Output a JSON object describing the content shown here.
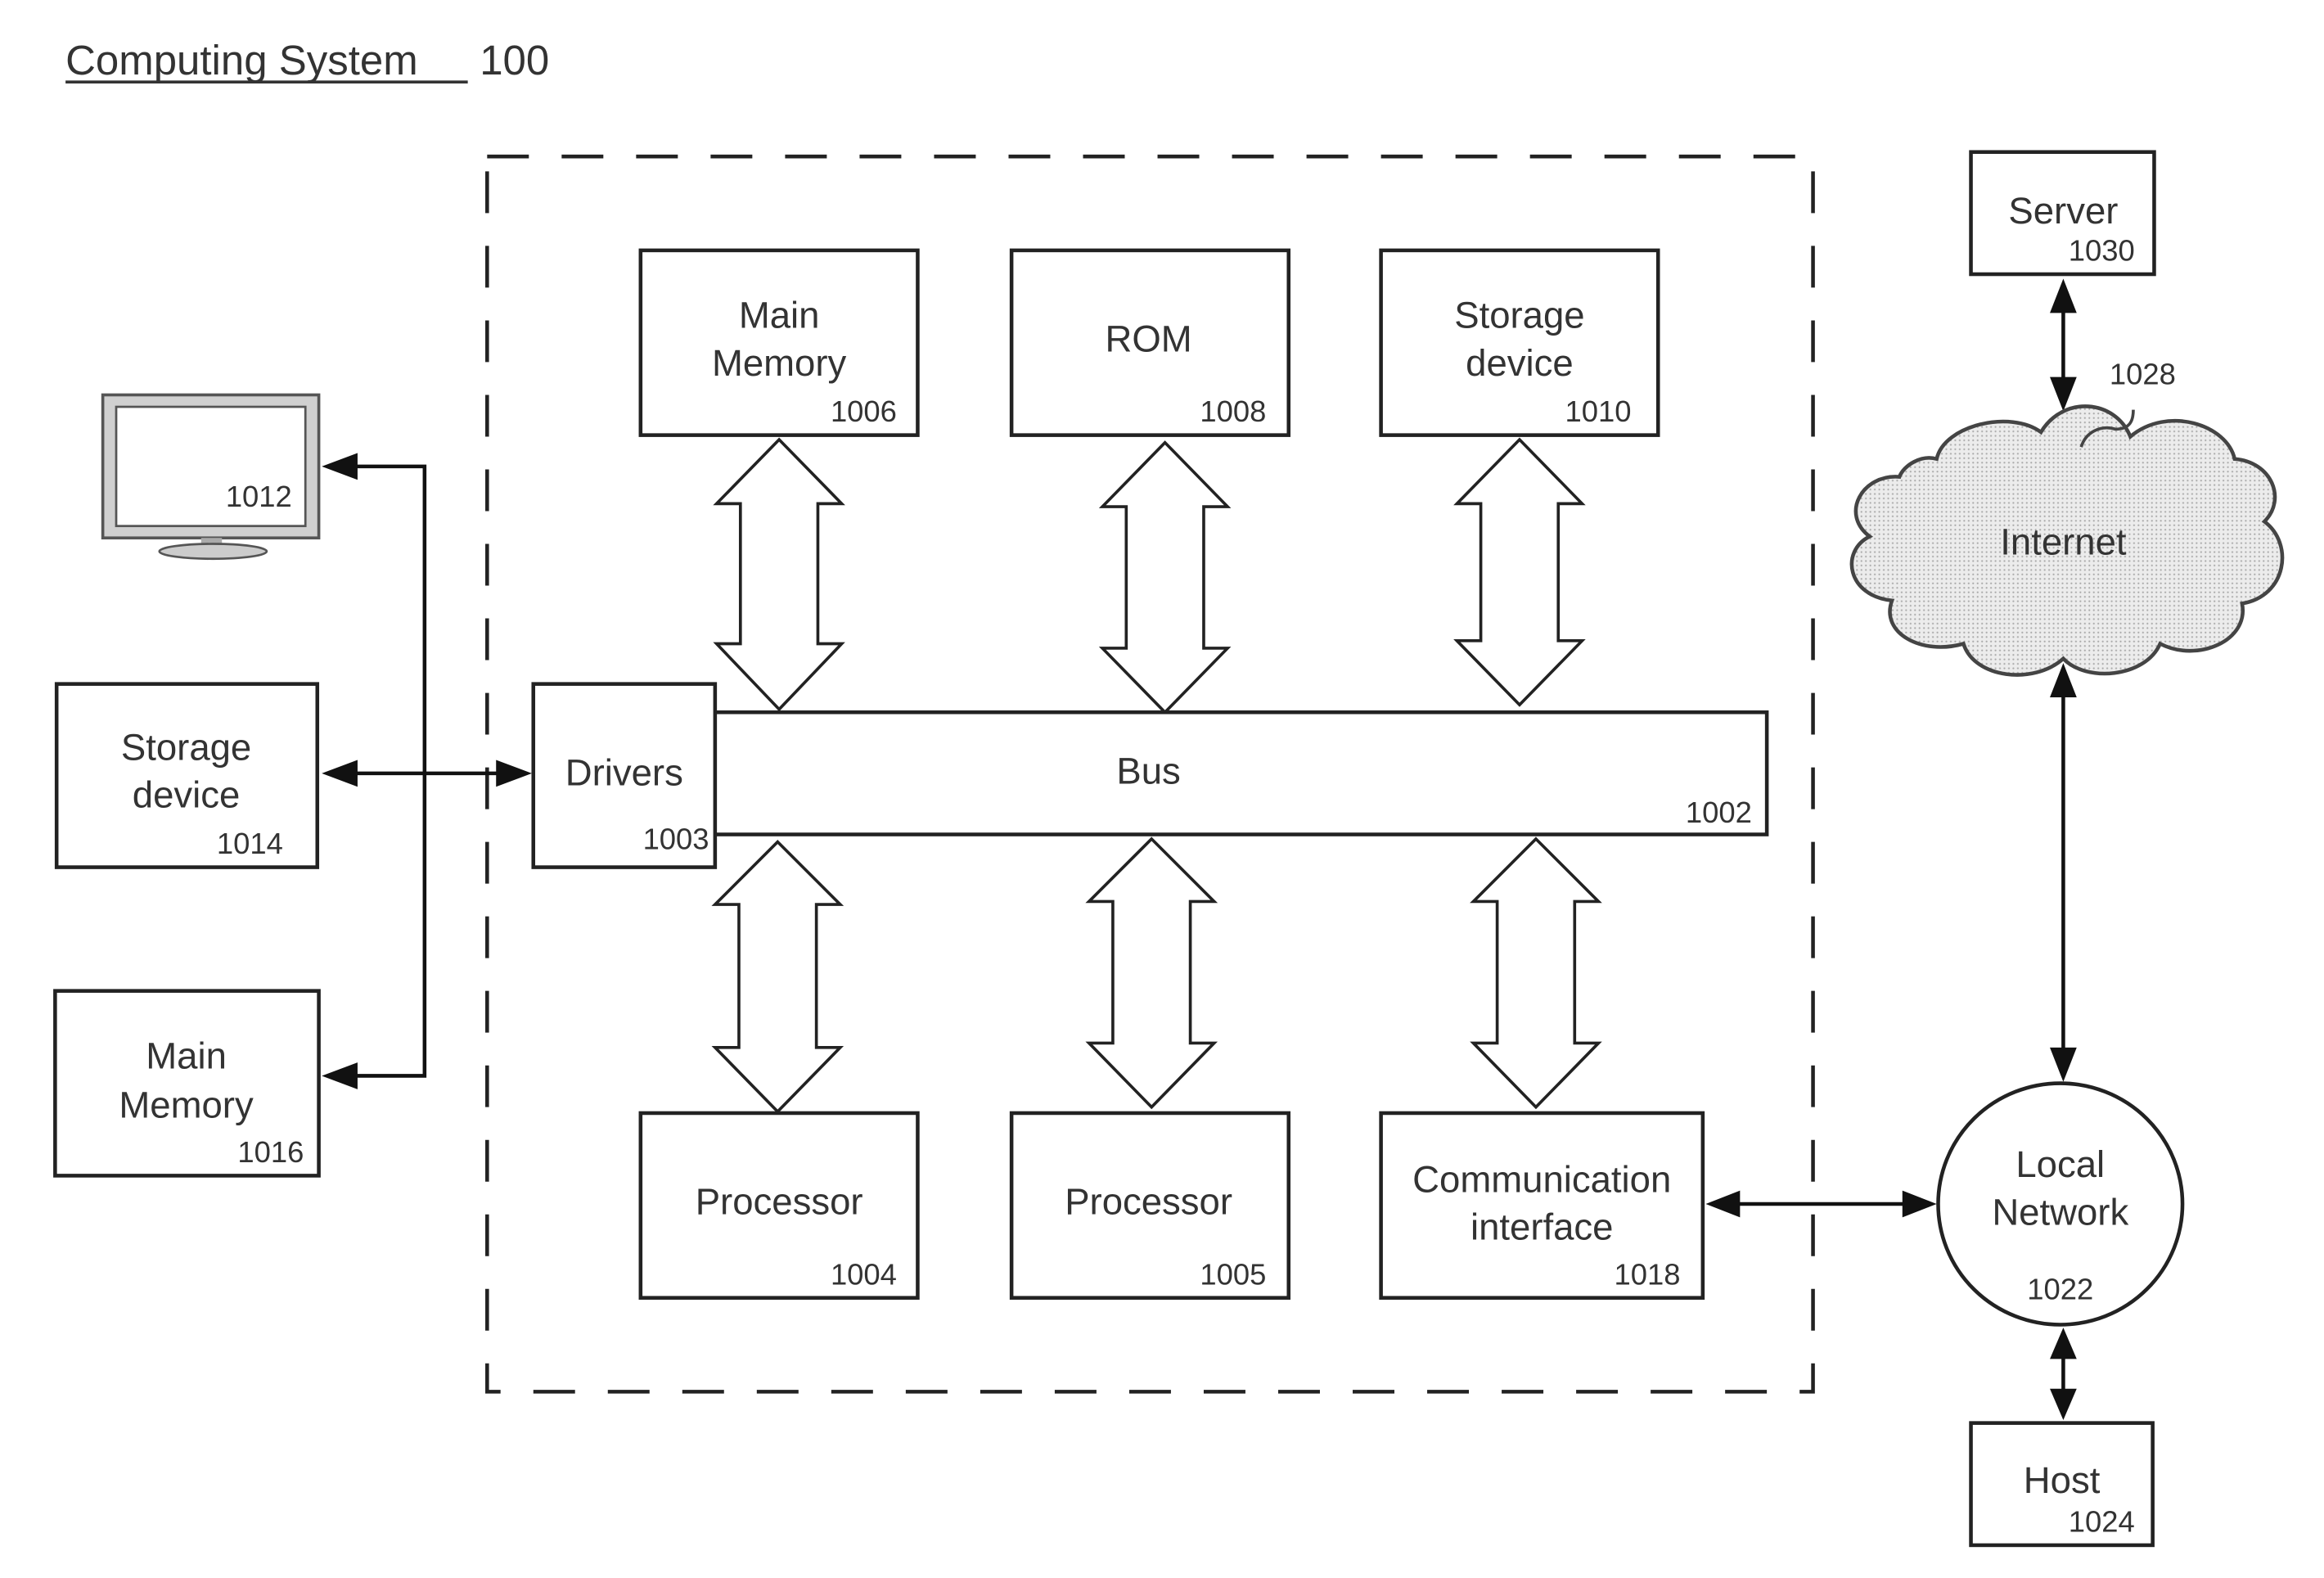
{
  "title": {
    "name": "Computing System",
    "ref": "100"
  },
  "nodes": {
    "main_memory_inner": {
      "lines": [
        "Main",
        "Memory"
      ],
      "ref": "1006"
    },
    "rom": {
      "lines": [
        "ROM"
      ],
      "ref": "1008"
    },
    "storage_inner": {
      "lines": [
        "Storage",
        "device"
      ],
      "ref": "1010"
    },
    "drivers": {
      "lines": [
        "Drivers"
      ],
      "ref": "1003"
    },
    "bus": {
      "lines": [
        "Bus"
      ],
      "ref": "1002"
    },
    "processor_a": {
      "lines": [
        "Processor"
      ],
      "ref": "1004"
    },
    "processor_b": {
      "lines": [
        "Processor"
      ],
      "ref": "1005"
    },
    "comm_interface": {
      "lines": [
        "Communication",
        "interface"
      ],
      "ref": "1018"
    },
    "display": {
      "ref": "1012"
    },
    "storage_ext": {
      "lines": [
        "Storage",
        "device"
      ],
      "ref": "1014"
    },
    "main_memory_ext": {
      "lines": [
        "Main",
        "Memory"
      ],
      "ref": "1016"
    },
    "server": {
      "lines": [
        "Server"
      ],
      "ref": "1030"
    },
    "internet": {
      "lines": [
        "Internet"
      ],
      "ref": "1028"
    },
    "local_network": {
      "lines": [
        "Local",
        "Network"
      ],
      "ref": "1022"
    },
    "host": {
      "lines": [
        "Host"
      ],
      "ref": "1024"
    }
  }
}
